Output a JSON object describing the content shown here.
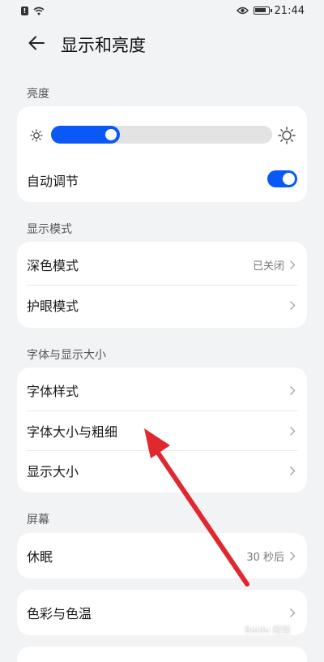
{
  "status": {
    "time": "21:44"
  },
  "header": {
    "title": "显示和亮度"
  },
  "brightness": {
    "section_label": "亮度",
    "level": 0.31,
    "auto_label": "自动调节",
    "auto_on": true
  },
  "display_mode": {
    "section_label": "显示模式",
    "items": [
      {
        "label": "深色模式",
        "value": "已关闭"
      },
      {
        "label": "护眼模式",
        "value": ""
      }
    ]
  },
  "font_size": {
    "section_label": "字体与显示大小",
    "items": [
      {
        "label": "字体样式"
      },
      {
        "label": "字体大小与粗细"
      },
      {
        "label": "显示大小"
      }
    ]
  },
  "screen": {
    "section_label": "屏幕",
    "sleep": {
      "label": "休眠",
      "value": "30 秒后"
    }
  },
  "color": {
    "label": "色彩与色温"
  },
  "colors": {
    "accent": "#0a59f7",
    "annotation": "#e0282e"
  },
  "watermark": {
    "text": "Baidu 经验"
  }
}
